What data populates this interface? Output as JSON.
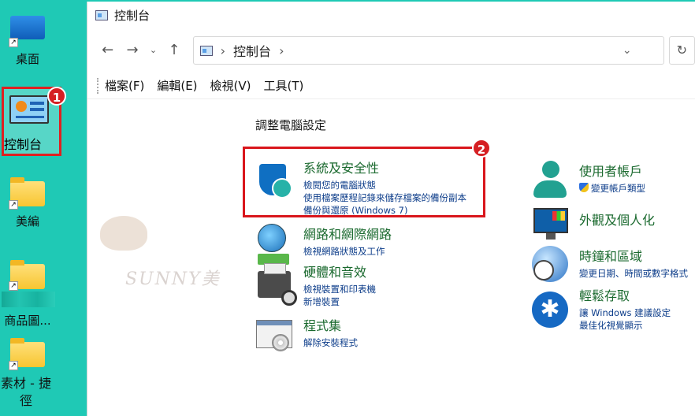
{
  "desktop": {
    "items": [
      {
        "label": "桌面"
      },
      {
        "label": "控制台"
      },
      {
        "label": "美編"
      },
      {
        "label": "商品圖..."
      },
      {
        "label": "素材 - 捷徑"
      }
    ],
    "badge1": "1"
  },
  "window": {
    "title": "控制台",
    "address": {
      "crumb": "控制台"
    },
    "menu": [
      "檔案(F)",
      "編輯(E)",
      "檢視(V)",
      "工具(T)"
    ],
    "heading": "調整電腦設定",
    "badge2": "2",
    "left_categories": [
      {
        "title": "系統及安全性",
        "links": [
          "檢閱您的電腦狀態",
          "使用檔案歷程記錄來儲存檔案的備份副本",
          "備份與還原 (Windows 7)"
        ]
      },
      {
        "title": "網路和網際網路",
        "links": [
          "檢視網路狀態及工作"
        ]
      },
      {
        "title": "硬體和音效",
        "links": [
          "檢視裝置和印表機",
          "新增裝置"
        ]
      },
      {
        "title": "程式集",
        "links": [
          "解除安裝程式"
        ]
      }
    ],
    "right_categories": [
      {
        "title": "使用者帳戶",
        "links": [
          "變更帳戶類型"
        ]
      },
      {
        "title": "外觀及個人化",
        "links": []
      },
      {
        "title": "時鐘和區域",
        "links": [
          "變更日期、時間或數字格式"
        ]
      },
      {
        "title": "輕鬆存取",
        "links": [
          "讓 Windows 建議設定",
          "最佳化視覺顯示"
        ]
      }
    ],
    "watermark": "SUNNY美"
  },
  "colors": {
    "desktop_bg": "#1fc9b5",
    "highlight": "#d9161c",
    "category_title": "#1b6a2f",
    "link": "#0d3d8a"
  }
}
